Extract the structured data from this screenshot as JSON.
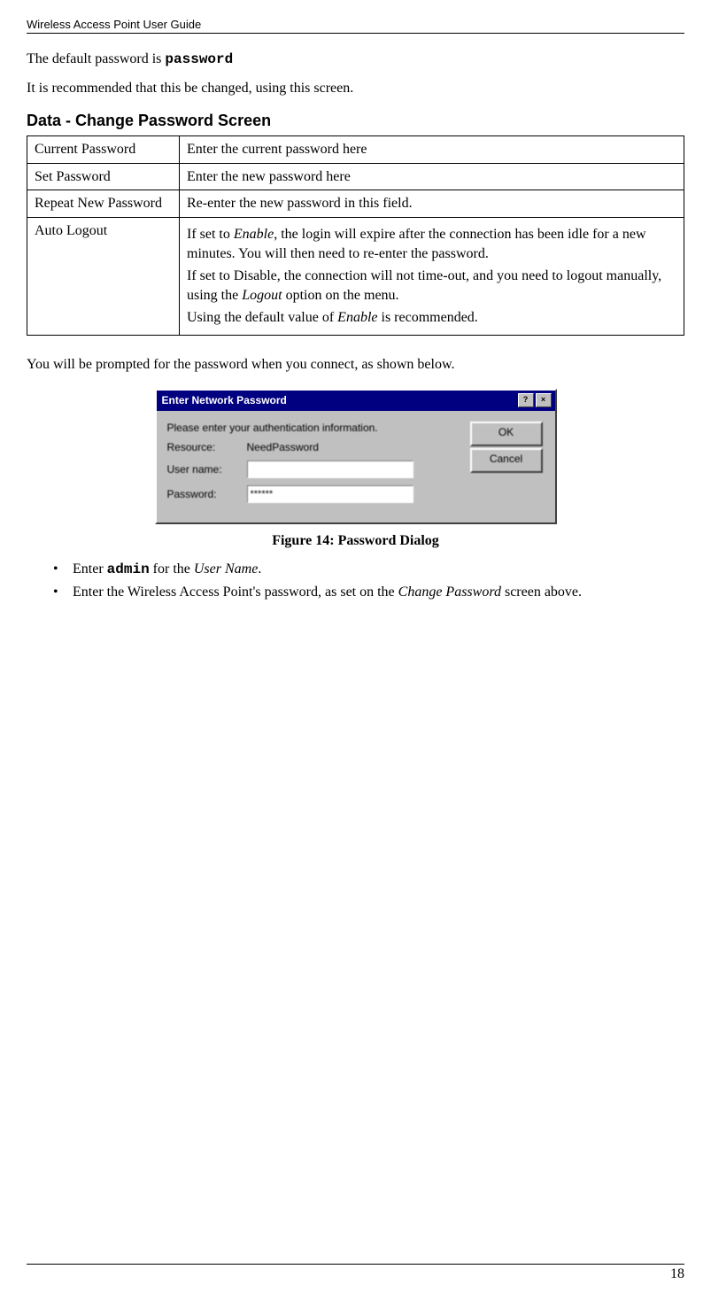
{
  "header": "Wireless Access Point User Guide",
  "p1_pre": "The default password is ",
  "p1_code": "password",
  "p2": "It is recommended that this be changed, using this screen.",
  "section_heading": "Data - Change Password Screen",
  "table": {
    "r1": {
      "label": "Current Password",
      "desc": "Enter the current password here"
    },
    "r2": {
      "label": "Set Password",
      "desc": "Enter the new password here"
    },
    "r3": {
      "label": "Repeat New Password",
      "desc": "Re-enter the new password in this field."
    },
    "r4": {
      "label": "Auto Logout",
      "p1_a": "If set to ",
      "p1_em": "Enable",
      "p1_b": ", the login will expire after the connection has been idle for a new minutes. You will then need to re-enter the password.",
      "p2_a": "If set to Disable, the connection will not time-out, and you need to logout manually, using the ",
      "p2_em": "Logout",
      "p2_b": " option on the menu.",
      "p3_a": "Using the default value of ",
      "p3_em": "Enable",
      "p3_b": " is recommended."
    }
  },
  "p3": "You will be prompted for the password when you connect, as shown below.",
  "dialog": {
    "title": "Enter Network Password",
    "prompt": "Please enter your authentication information.",
    "resource_label": "Resource:",
    "resource_value": "NeedPassword",
    "username_label": "User name:",
    "username_value": "",
    "password_label": "Password:",
    "password_value": "******",
    "ok": "OK",
    "cancel": "Cancel"
  },
  "figure_caption": "Figure 14:  Password Dialog",
  "bullets": {
    "b1_a": "Enter ",
    "b1_code": "admin",
    "b1_b": " for the ",
    "b1_em": "User Name",
    "b1_c": ".",
    "b2_a": "Enter the Wireless Access Point's password, as set on the ",
    "b2_em": "Change Password",
    "b2_b": " screen above."
  },
  "page_number": "18"
}
